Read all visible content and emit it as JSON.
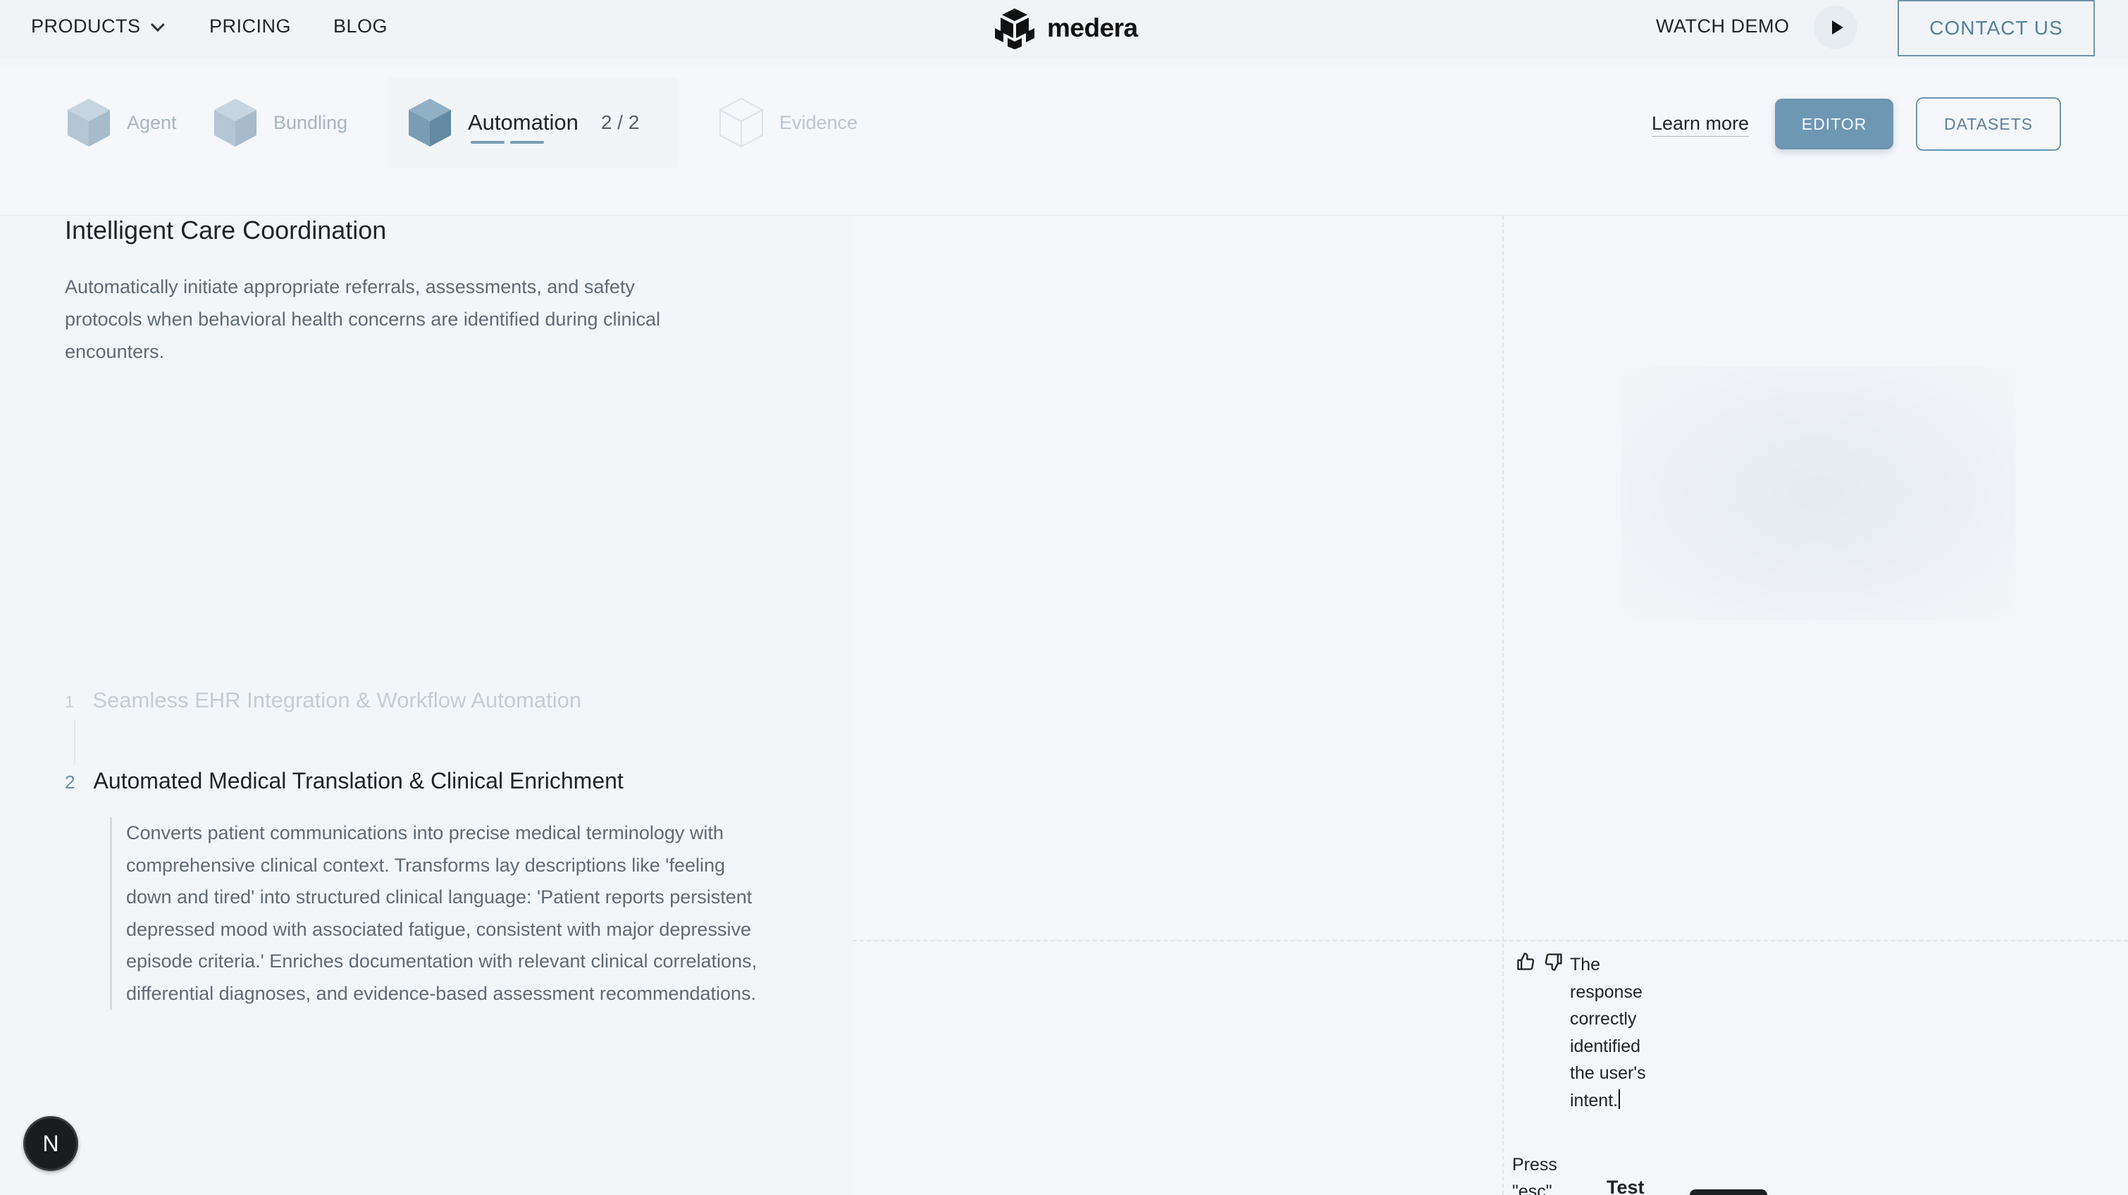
{
  "nav": {
    "products": "PRODUCTS",
    "pricing": "PRICING",
    "blog": "BLOG",
    "brand": "medera",
    "watch_demo": "WATCH DEMO",
    "contact": "CONTACT US"
  },
  "steps": {
    "agent": "Agent",
    "bundling": "Bundling",
    "automation": "Automation",
    "automation_count": "2 / 2",
    "evidence": "Evidence",
    "learn_more": "Learn more",
    "editor": "EDITOR",
    "datasets": "DATASETS"
  },
  "content": {
    "title": "Intelligent Care Coordination",
    "description": "Automatically initiate appropriate referrals, assessments, and safety protocols when behavioral health concerns are identified during clinical encounters.",
    "features": [
      {
        "num": "1",
        "title": "Seamless EHR Integration & Workflow Automation"
      },
      {
        "num": "2",
        "title": "Automated Medical Translation & Clinical Enrichment",
        "detail": "Converts patient communications into precise medical terminology with comprehensive clinical context. Transforms lay descriptions like 'feeling down and tired' into structured clinical language: 'Patient reports persistent depressed mood with associated fatigue, consistent with major depressive episode criteria.' Enriches documentation with relevant clinical correlations, differential diagnoses, and evidence-based assessment recommendations."
      }
    ]
  },
  "feedback": {
    "text": "The response correctly identified the user's intent.",
    "press_hint_line1": "Press",
    "press_hint_line2": "\"esc\"",
    "test_label": "Test"
  },
  "avatar": {
    "letter": "N"
  },
  "colors": {
    "accent": "#6e97b3",
    "accent_border": "#6f94ad",
    "background": "#f3f6f9"
  },
  "icons": [
    "chevron-down-icon",
    "medera-logo-icon",
    "play-icon",
    "cube-icon",
    "thumbs-up-icon",
    "thumbs-down-icon"
  ]
}
